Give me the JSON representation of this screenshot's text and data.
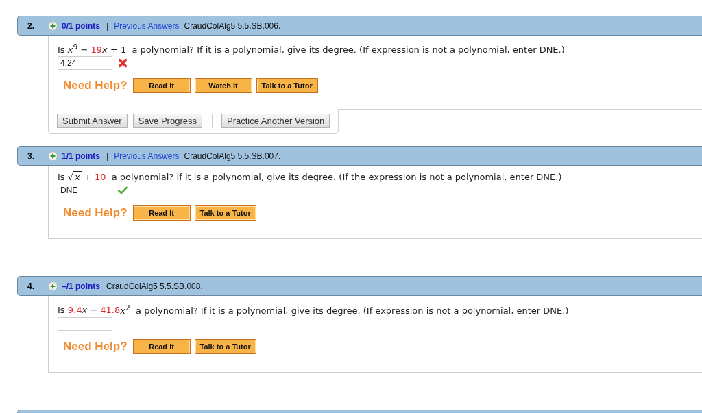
{
  "questions": [
    {
      "number": "2.",
      "points": "0/1 points",
      "separator": "|",
      "previous_answers": "Previous Answers",
      "code": "CraudColAlg5 5.5.SB.006.",
      "prompt": [
        {
          "kind": "text",
          "text": "Is *x*$^{9}$ − "
        },
        {
          "kind": "highlight",
          "text": "19"
        },
        {
          "kind": "text",
          "text": "*x* + 1  a polynomial? If it is a polynomial, give its degree. (If expression is not a polynomial, enter DNE.)"
        }
      ],
      "answer": "4.24",
      "correct": false,
      "need_help": "Need Help?",
      "help_buttons": [
        "Read It",
        "Watch It",
        "Talk to a Tutor"
      ],
      "footer": {
        "buttons": [
          "Submit Answer",
          "Save Progress"
        ],
        "after_divider": [
          "Practice Another Version"
        ]
      }
    },
    {
      "number": "3.",
      "points": "1/1 points",
      "separator": "|",
      "previous_answers": "Previous Answers",
      "code": "CraudColAlg5 5.5.SB.007.",
      "prompt": [
        {
          "kind": "text",
          "text": "Is √"
        },
        {
          "kind": "radicand",
          "text": "*x*"
        },
        {
          "kind": "text",
          "text": " + "
        },
        {
          "kind": "highlight",
          "text": "10"
        },
        {
          "kind": "text",
          "text": "  a polynomial? If it is a polynomial, give its degree. (If the expression is not a polynomial, enter DNE.)"
        }
      ],
      "answer": "DNE",
      "correct": true,
      "need_help": "Need Help?",
      "help_buttons": [
        "Read It",
        "Talk to a Tutor"
      ]
    },
    {
      "number": "4.",
      "points": "–/1 points",
      "code": "CraudColAlg5 5.5.SB.008.",
      "prompt": [
        {
          "kind": "text",
          "text": "Is "
        },
        {
          "kind": "highlight",
          "text": "9.4"
        },
        {
          "kind": "text",
          "text": "*x* − "
        },
        {
          "kind": "highlight",
          "text": "41.8"
        },
        {
          "kind": "text",
          "text": "*x*$^{2}$  a polynomial? If it is a polynomial, give its degree. (If expression is not a polynomial, enter DNE.)"
        }
      ],
      "need_help": "Need Help?",
      "help_buttons": [
        "Read It",
        "Talk to a Tutor"
      ]
    }
  ]
}
